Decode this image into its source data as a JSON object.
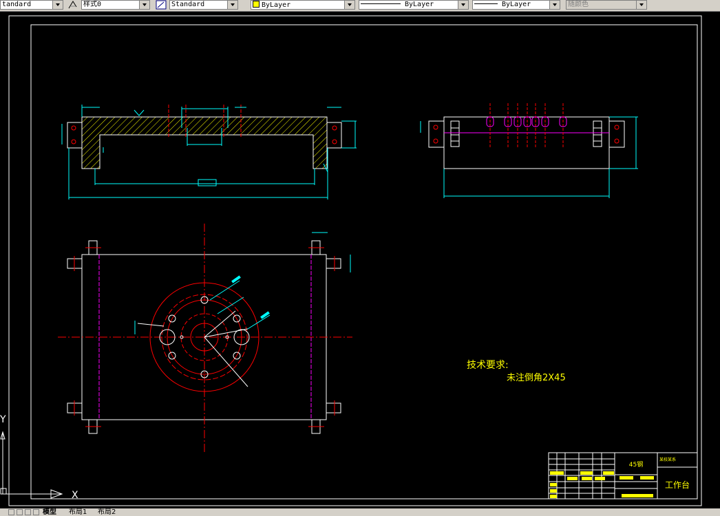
{
  "toolbar": {
    "text_style": "tandard",
    "table_style": "样式0",
    "dim_style": "Standard",
    "layer": "ByLayer",
    "linetype": "ByLayer",
    "lineweight": "ByLayer",
    "plot_style": "随颜色"
  },
  "notes": {
    "heading": "技术要求:",
    "line1": "未注倒角2X45"
  },
  "title_block": {
    "material": "45钢",
    "part_name": "工作台",
    "school": "某校某系"
  },
  "ucs": {
    "x": "X",
    "y": "Y"
  },
  "tabs": [
    "模型",
    "布局1",
    "布局2"
  ],
  "colors": {
    "background": "#000000",
    "outline": "#ffffff",
    "dimension": "#00ffff",
    "centerline": "#ff0000",
    "hatch": "#ffff00",
    "hidden": "#ff00ff",
    "annotation": "#ffff00"
  }
}
